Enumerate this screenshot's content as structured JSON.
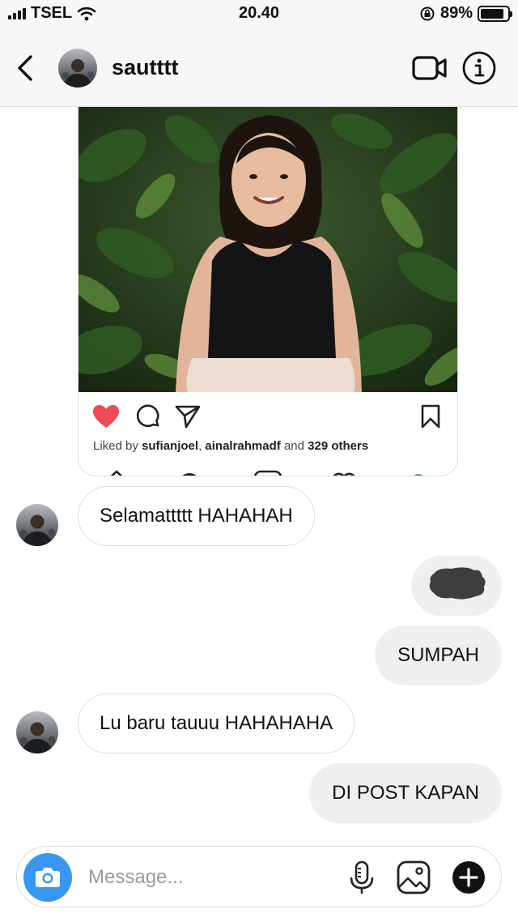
{
  "status_bar": {
    "carrier": "TSEL",
    "time": "20.40",
    "battery_percent": "89%",
    "battery_level": 0.89
  },
  "header": {
    "username": "sautttt",
    "icons": {
      "back": "chevron-left-icon",
      "video": "video-camera-icon",
      "info": "info-icon"
    }
  },
  "post": {
    "liked": true,
    "likes_prefix": "Liked by ",
    "liker_1": "sufianjoel",
    "likes_sep": ", ",
    "liker_2": "ainalrahmadf",
    "likes_and": " and ",
    "likes_count": "329 others",
    "colors": {
      "heart": "#ed4956"
    }
  },
  "messages": [
    {
      "direction": "incoming",
      "text": "Selamattttt HAHAHAH"
    },
    {
      "direction": "outgoing",
      "text": "",
      "redacted": true
    },
    {
      "direction": "outgoing",
      "text": "SUMPAH"
    },
    {
      "direction": "incoming",
      "text": "Lu baru tauuu HAHAHAHA"
    },
    {
      "direction": "outgoing",
      "text": "DI POST KAPAN"
    }
  ],
  "composer": {
    "placeholder": "Message...",
    "value": "",
    "camera_color": "#3897f0"
  }
}
